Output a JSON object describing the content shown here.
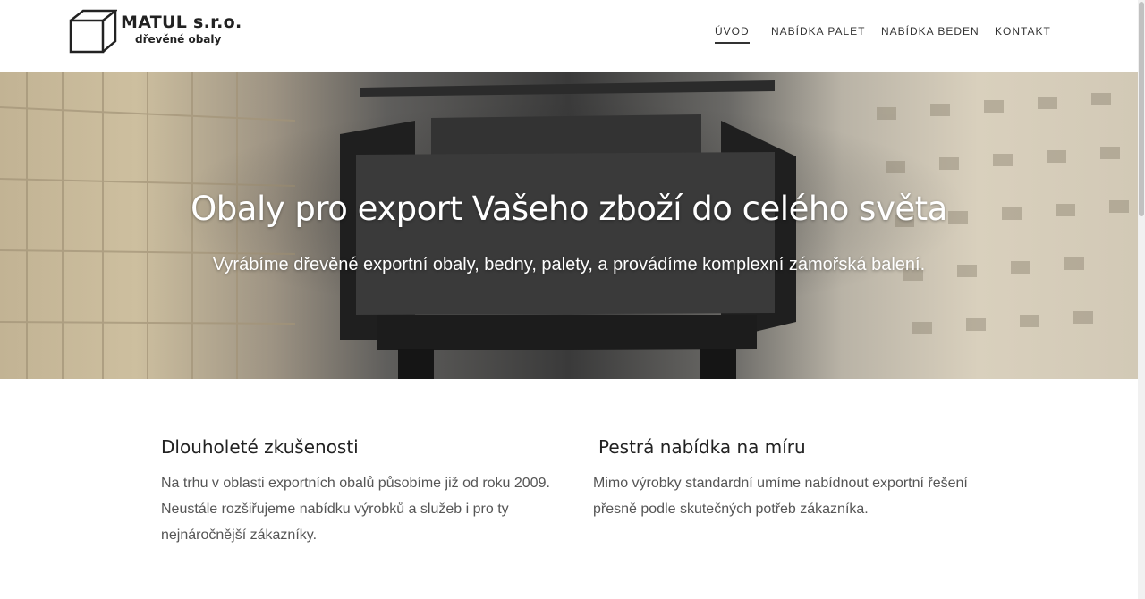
{
  "header": {
    "logo_name": "MATUL s.r.o.",
    "logo_sub": "dřevěné obaly",
    "nav": [
      {
        "label": "ÚVOD",
        "active": true
      },
      {
        "label": "NABÍDKA PALET",
        "active": false
      },
      {
        "label": "NABÍDKA BEDEN",
        "active": false
      },
      {
        "label": "KONTAKT",
        "active": false
      }
    ]
  },
  "hero": {
    "title": "Obaly pro export Vašeho zboží do celého světa",
    "subtitle": "Vyrábíme dřevěné exportní obaly, bedny, palety, a provádíme komplexní zámořská balení."
  },
  "features": [
    {
      "title": "Dlouholeté zkušenosti",
      "text": "Na trhu v oblasti exportních obalů působíme již od roku 2009. Neustále rozšiřujeme nabídku výrobků a služeb i pro ty nejnáročnější zákazníky."
    },
    {
      "title": "Pestrá nabídka na míru",
      "text": "Mimo výrobky standardní umíme nabídnout exportní řešení přesně podle skutečných potřeb zákazníka."
    }
  ],
  "colors": {
    "hero_text": "#ffffff",
    "box_dark": "#2e2e2e",
    "wood": "#d4c7ab"
  },
  "icons": {
    "logo": "box-logo-icon"
  }
}
